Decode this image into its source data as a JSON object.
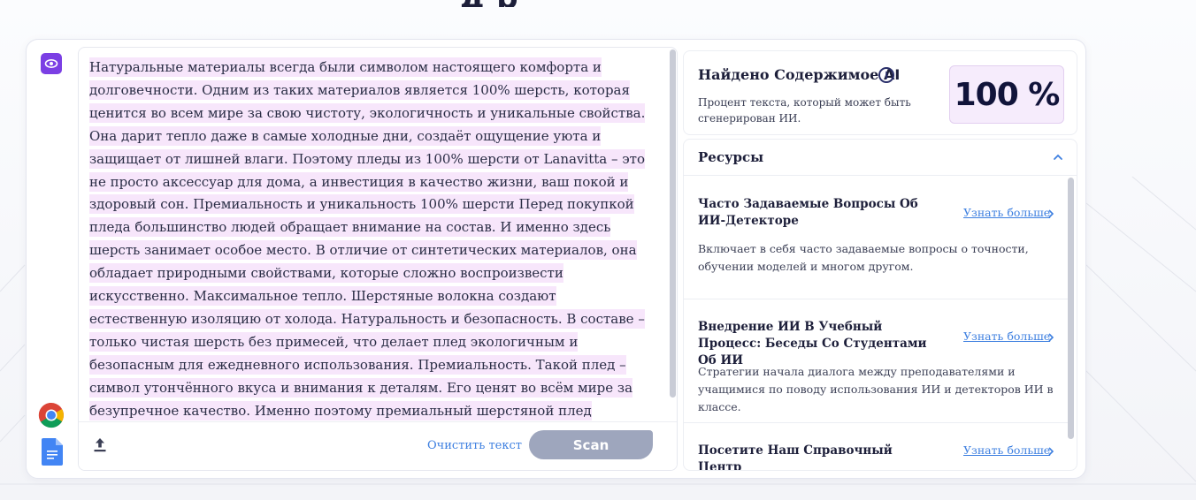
{
  "page": {
    "top_heading_fragment": "д р"
  },
  "sidebar": {
    "icons": [
      "eye-icon",
      "chrome-icon",
      "google-docs-icon"
    ]
  },
  "editor": {
    "paragraph": "Натуральные материалы всегда были символом настоящего комфорта и долговечности. Одним из таких материалов является 100% шерсть, которая ценится во всем мире за свою чистоту, экологичность и уникальные свойства. Она дарит тепло даже в самые холодные дни, создаёт ощущение уюта и защищает от лишней влаги. Поэтому пледы из 100% шерсти от Lanavitta – это не просто аксессуар для дома, а инвестиция в качество жизни, ваш покой и здоровый сон. Премиальность и уникальность 100% шерсти Перед покупкой пледа большинство людей обращает внимание на состав. И именно здесь шерсть занимает особое место. В отличие от синтетических материалов, она обладает природными свойствами, которые сложно воспроизвести искусственно. Максимальное тепло. Шерстяные волокна создают естественную изоляцию от холода. Натуральность и безопасность. В составе – только чистая шерсть без примесей, что делает плед экологичным и безопасным для ежедневного использования. Премиальность. Такой плед – символ утончённого вкуса и внимания к деталям. Его ценят во всём мире за безупречное качество. Именно поэтому премиальный шерстяной плед становится достойным украшением",
    "clear_label": "Очистить текст",
    "scan_label": "Scan",
    "upload_icon": "upload-icon"
  },
  "result": {
    "title_main": "Найдено Содержимое ",
    "title_ai": "AI",
    "info_icon_text": "i",
    "description": "Процент текста, который может быть сгенерирован ИИ.",
    "percent": "100 %",
    "percent_value": 100,
    "accent_color": "#f6ecfc"
  },
  "resources": {
    "title": "Ресурсы",
    "items": [
      {
        "title": "Часто Задаваемые Вопросы Об ИИ-Детекторе",
        "link": "Узнать больше",
        "description": "Включает в себя часто задаваемые вопросы о точности, обучении моделей и многом другом."
      },
      {
        "title": "Внедрение ИИ В Учебный Процесс: Беседы Со Студентами Об ИИ",
        "link": "Узнать больше",
        "description": "Стратегии начала диалога между преподавателями и учащимися по поводу использования ИИ и детекторов ИИ в классе."
      },
      {
        "title": "Посетите Наш Справочный Центр",
        "link": "Узнать больше",
        "description": ""
      }
    ]
  }
}
